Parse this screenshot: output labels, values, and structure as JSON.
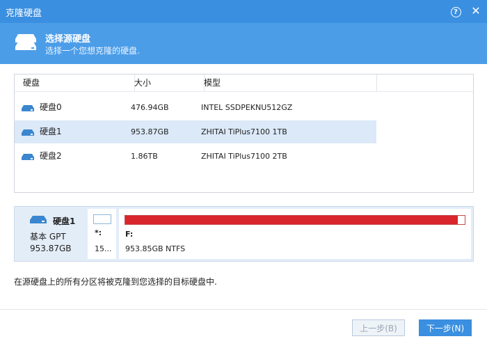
{
  "window": {
    "title": "克隆硬盘",
    "help_label": "?",
    "close_label": "✕"
  },
  "header": {
    "title": "选择源硬盘",
    "subtitle": "选择一个您想克隆的硬盘."
  },
  "table": {
    "columns": [
      "硬盘",
      "大小",
      "模型"
    ],
    "rows": [
      {
        "name": "硬盘0",
        "size": "476.94GB",
        "model": "INTEL SSDPEKNU512GZ",
        "selected": false
      },
      {
        "name": "硬盘1",
        "size": "953.87GB",
        "model": "ZHITAI TiPlus7100 1TB",
        "selected": true
      },
      {
        "name": "硬盘2",
        "size": "1.86TB",
        "model": "ZHITAI TiPlus7100 2TB",
        "selected": false
      }
    ]
  },
  "selected_disk": {
    "name": "硬盘1",
    "type": "基本 GPT",
    "size": "953.87GB",
    "partitions": [
      {
        "label": "*:",
        "size": "15...",
        "used_fraction": 0.0
      },
      {
        "label": "F:",
        "size": "953.85GB NTFS",
        "used_fraction": 0.98
      }
    ]
  },
  "note": "在源硬盘上的所有分区将被克隆到您选择的目标硬盘中.",
  "buttons": {
    "prev": "上一步(B)",
    "next": "下一步(N)"
  },
  "colors": {
    "title_bar": "#3a8fe0",
    "header": "#4c9de8",
    "used_space": "#d9262c",
    "selected_row": "#dbe9f8"
  },
  "icons": {
    "disk": "disk-icon",
    "help": "help-icon",
    "close": "close-icon"
  }
}
